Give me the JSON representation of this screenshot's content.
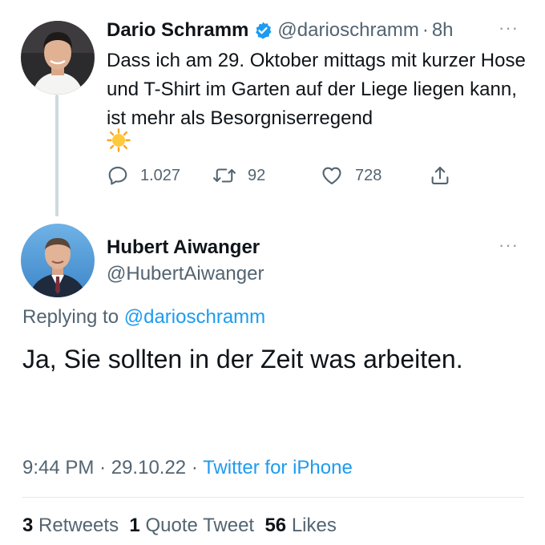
{
  "original_tweet": {
    "author_name": "Dario Schramm",
    "handle": "@darioschramm",
    "separator": "·",
    "time": "8h",
    "more_icon": "···",
    "text": "Dass ich am 29. Oktober mittags mit kurzer Hose und T-Shirt im Garten auf der Liege liegen kann, ist mehr als Besorgniserregend",
    "emoji": "sun-emoji",
    "actions": {
      "replies": "1.027",
      "retweets": "92",
      "likes": "728"
    },
    "verified_color": "#1d9bf0"
  },
  "reply_tweet": {
    "author_name": "Hubert Aiwanger",
    "handle": "@HubertAiwanger",
    "more_icon": "···",
    "replying_to_label": "Replying to",
    "replying_to_handle": "@darioschramm",
    "text": "Ja, Sie sollten in der Zeit was arbeiten.",
    "time": "9:44 PM",
    "separator": "·",
    "date": "29.10.22",
    "source": "Twitter for iPhone",
    "stats": {
      "retweets_count": "3",
      "retweets_label": "Retweets",
      "quote_count": "1",
      "quote_label": "Quote Tweet",
      "likes_count": "56",
      "likes_label": "Likes"
    }
  },
  "colors": {
    "link": "#1d9bf0",
    "secondary_text": "#536471",
    "primary_text": "#0f1419"
  }
}
